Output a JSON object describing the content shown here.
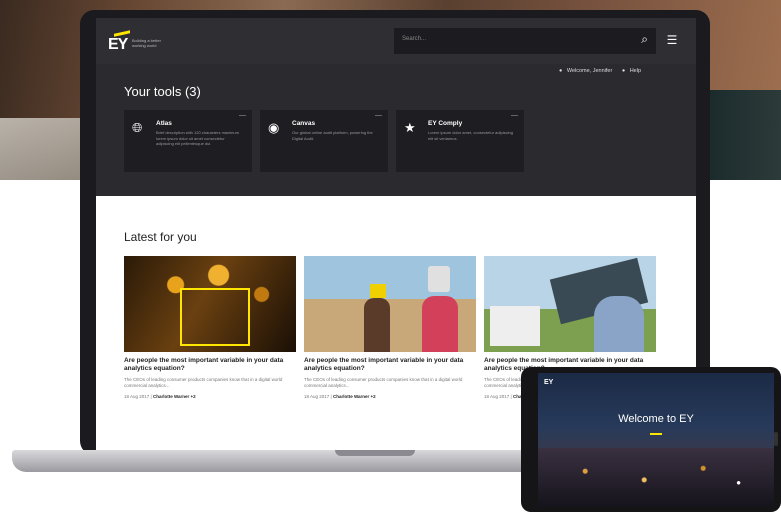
{
  "header": {
    "logo_text": "EY",
    "logo_tagline": "Building a better working world",
    "search_placeholder": "Search...",
    "welcome_text": "Welcome, Jennifer",
    "help_label": "Help"
  },
  "tools": {
    "title": "Your tools (3)",
    "items": [
      {
        "name": "Atlas",
        "icon": "globe-icon",
        "desc": "Brief description with 120 characters maximum lorem ipsum dolor sit amet consectetur adipiscing elit pellentesque dui."
      },
      {
        "name": "Canvas",
        "icon": "palette-icon",
        "desc": "Our global online audit platform, powering the Digital Audit."
      },
      {
        "name": "EY Comply",
        "icon": "star-icon",
        "desc": "Lorem ipsum dolor amet, consectetur adipiscing elit sit veniamus."
      }
    ]
  },
  "latest": {
    "title": "Latest for you",
    "articles": [
      {
        "title": "Are people the most important variable in your data analytics equation?",
        "desc": "The CEOs of leading consumer products companies know that in a digital world commercial analytics...",
        "date": "18 Aug 2017 |",
        "author": "Charlotte Warner +2"
      },
      {
        "title": "Are people the most important variable in your data analytics equation?",
        "desc": "The CEOs of leading consumer products companies know that in a digital world commercial analytics...",
        "date": "18 Aug 2017 |",
        "author": "Charlotte Warner +2"
      },
      {
        "title": "Are people the most important variable in your data analytics equation?",
        "desc": "The CEOs of leading consumer products companies know that in a digital world commercial analytics...",
        "date": "18 Aug 2017 |",
        "author": "Charlotte Warner +2"
      }
    ]
  },
  "tablet": {
    "logo_text": "EY",
    "welcome_text": "Welcome to EY"
  },
  "colors": {
    "accent": "#ffe600",
    "screen_bg": "#2a2a2f",
    "card_bg": "#1e1e22"
  }
}
